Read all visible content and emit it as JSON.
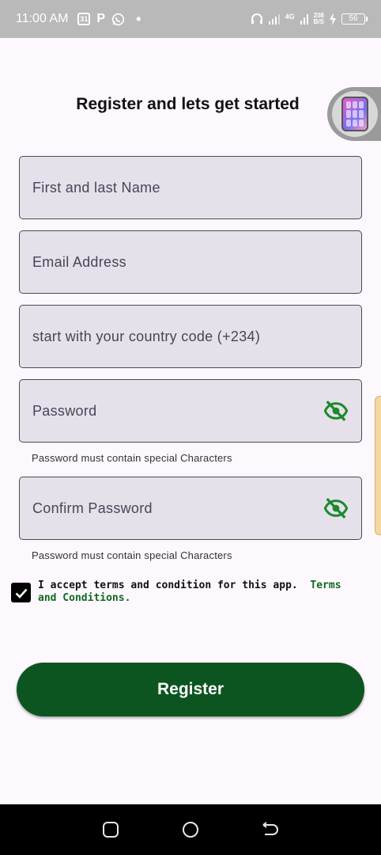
{
  "status_bar": {
    "time": "11:00 AM",
    "notif_icons": [
      "calendar-icon",
      "p-icon",
      "whatsapp-icon",
      "dot-icon"
    ],
    "network": "4G",
    "speed_top": "208",
    "speed_bottom": "B/S",
    "battery": "56"
  },
  "page": {
    "title": "Register and lets get started"
  },
  "form": {
    "name_placeholder": "First and last Name",
    "email_placeholder": "Email Address",
    "phone_placeholder": "start with your country code (+234)",
    "password_placeholder": "Password",
    "password_helper": "Password must contain special Characters",
    "confirm_placeholder": "Confirm Password",
    "confirm_helper": "Password must contain special Characters"
  },
  "terms": {
    "text": "I accept terms and condition for this app.",
    "link": "Terms and Conditions.",
    "checked": true
  },
  "actions": {
    "register_label": "Register"
  },
  "colors": {
    "accent": "#0c5520",
    "field_bg": "#e6e0ea",
    "eye_icon": "#1a8a2c"
  },
  "nav": {
    "icons": [
      "recents-icon",
      "home-icon",
      "back-icon"
    ]
  }
}
